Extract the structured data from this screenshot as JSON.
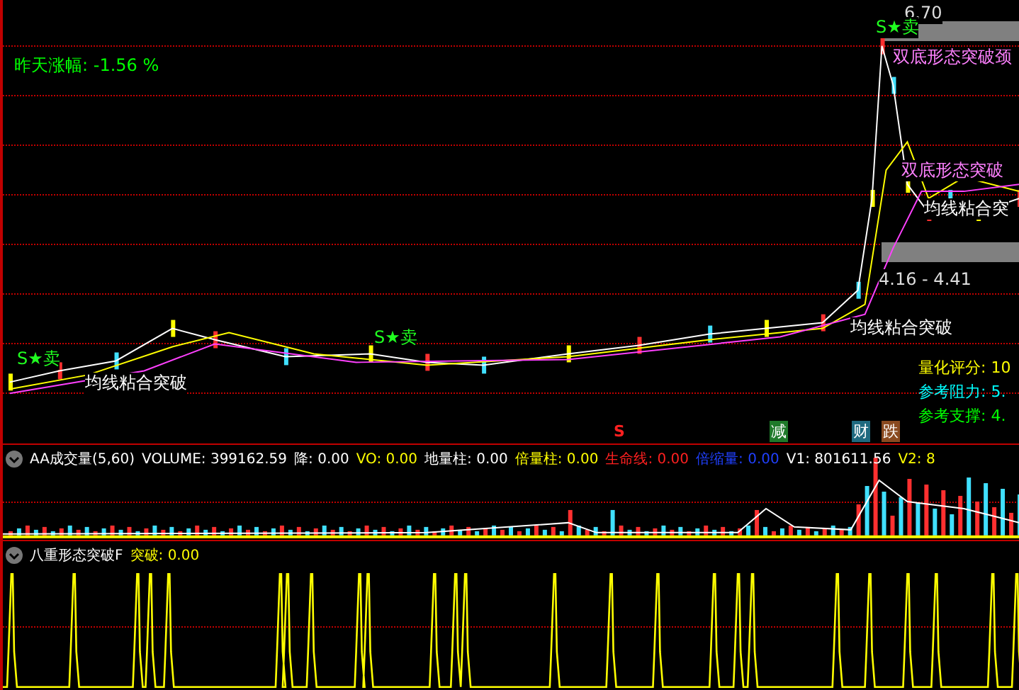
{
  "main_panel": {
    "change_label": "昨天涨幅:",
    "change_value": "-1.56 %",
    "high_price": "6.70",
    "range_label": "4.16 - 4.41",
    "signals": [
      {
        "text": "S★卖"
      },
      {
        "text": "S★卖"
      },
      {
        "text": "S★卖"
      }
    ],
    "pattern_labels": [
      {
        "kind": "double-bottom",
        "text": "双底形态突破颈"
      },
      {
        "kind": "double-bottom",
        "text": "双底形态突破"
      },
      {
        "kind": "ma-converge",
        "text": "均线粘合突破"
      },
      {
        "kind": "ma-converge",
        "text": "均线粘合突破"
      },
      {
        "kind": "ma-converge",
        "text": "均线粘合突"
      }
    ],
    "stats": [
      {
        "label": "量化评分:",
        "value": "10",
        "color": "#ffff00"
      },
      {
        "label": "参考阻力:",
        "value": "5.",
        "color": "#00ffff"
      },
      {
        "label": "参考支撑:",
        "value": "4.",
        "color": "#00ff00"
      }
    ],
    "markers": [
      {
        "text": "S",
        "color": "#ff2020"
      },
      {
        "text": "减",
        "color": "#1f7a2a"
      },
      {
        "text": "财",
        "color": "#1f6a80"
      },
      {
        "text": "跌",
        "color": "#8a4a20"
      }
    ]
  },
  "volume_panel": {
    "title": "AA成交量(5,60)",
    "fields": [
      {
        "label": "VOLUME:",
        "value": "399162.59",
        "color": "#ffffff"
      },
      {
        "label": "降:",
        "value": "0.00",
        "color": "#ffffff"
      },
      {
        "label": "VO:",
        "value": "0.00",
        "color": "#ffff00"
      },
      {
        "label": "地量柱:",
        "value": "0.00",
        "color": "#ffffff"
      },
      {
        "label": "倍量柱:",
        "value": "0.00",
        "color": "#ffff00"
      },
      {
        "label": "生命线:",
        "value": "0.00",
        "color": "#ff2020"
      },
      {
        "label": "倍缩量:",
        "value": "0.00",
        "color": "#2040ff"
      },
      {
        "label": "V1:",
        "value": "801611.56",
        "color": "#ffffff"
      },
      {
        "label": "V2:",
        "value": "8",
        "color": "#ffff00"
      }
    ]
  },
  "pattern_panel": {
    "title": "八重形态突破F",
    "fields": [
      {
        "label": "突破:",
        "value": "0.00",
        "color": "#ffff00"
      }
    ]
  }
}
